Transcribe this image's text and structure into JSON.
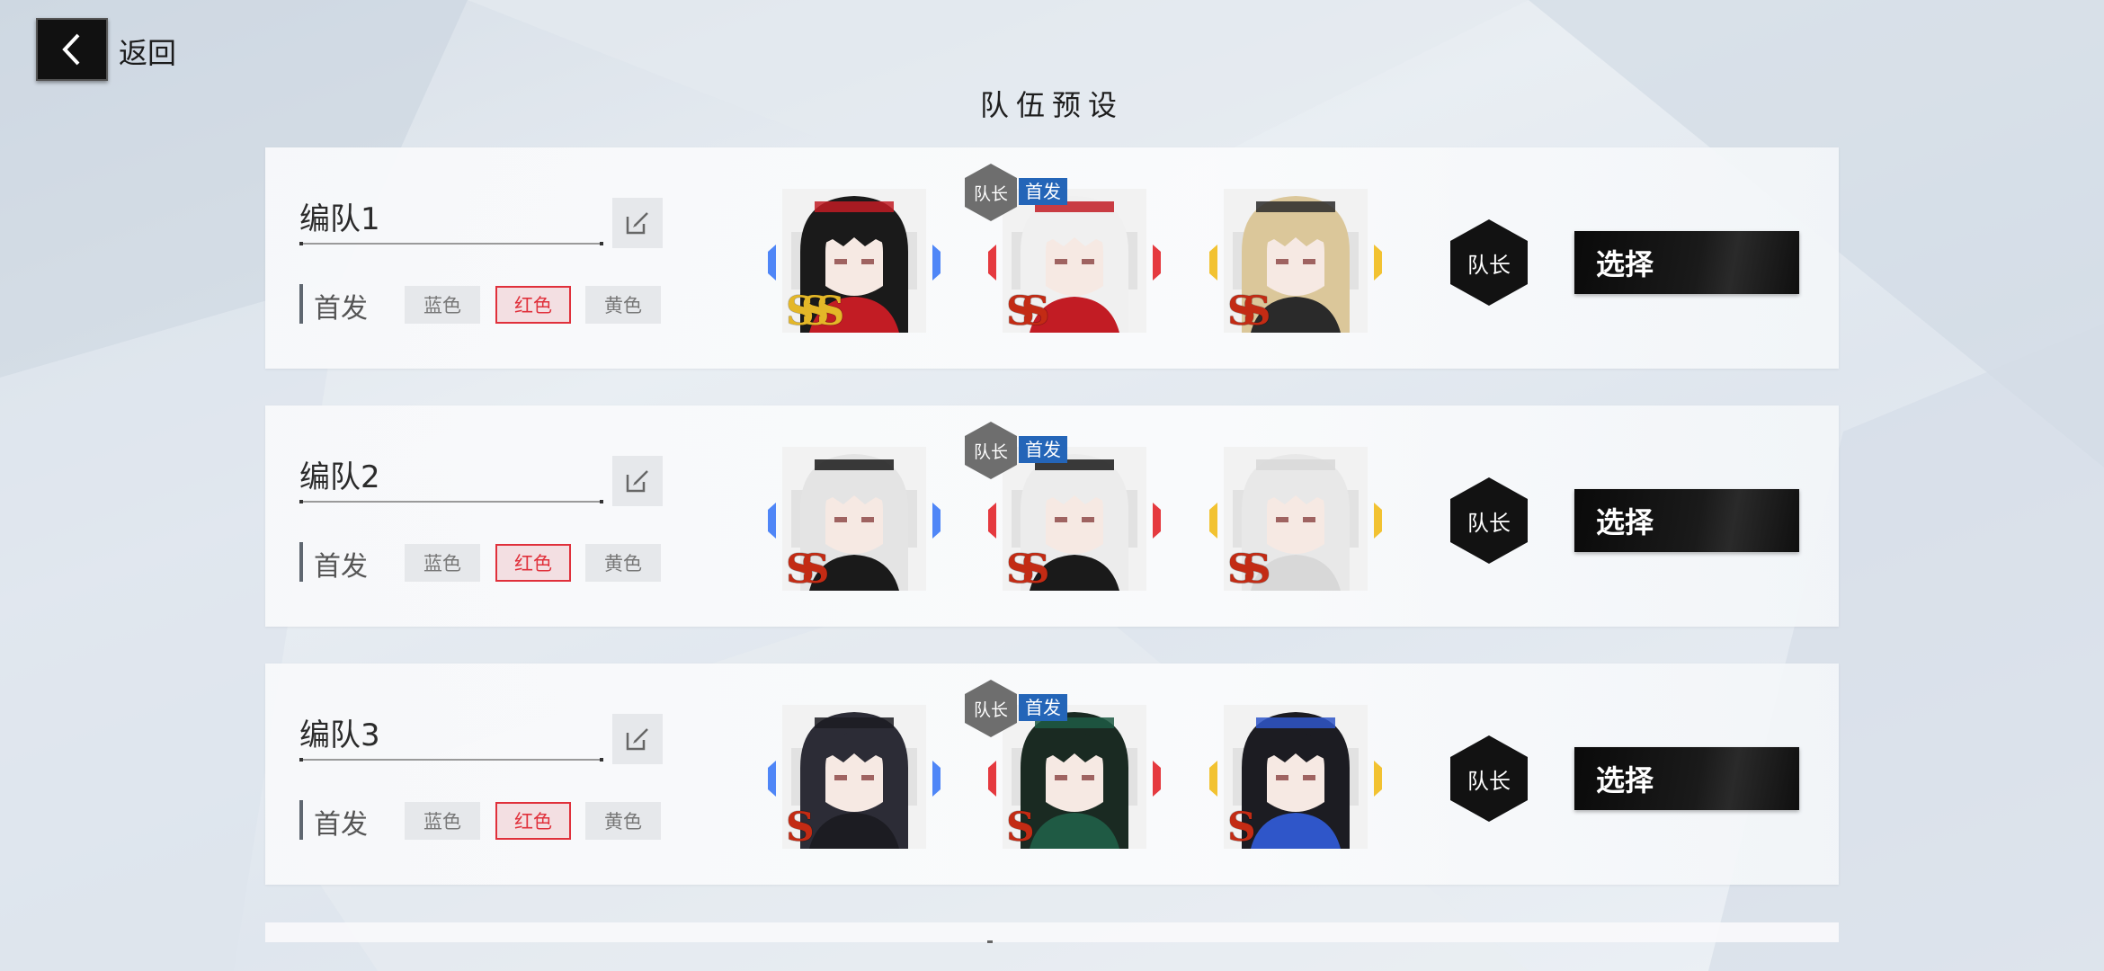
{
  "header": {
    "back_label": "返回",
    "title": "队伍预设"
  },
  "labels": {
    "leader_tag": "队长",
    "first_tag": "首发",
    "lead_label": "首发"
  },
  "teams": [
    {
      "name": "编队1",
      "colors": [
        {
          "label": "蓝色",
          "active": false
        },
        {
          "label": "红色",
          "active": true
        },
        {
          "label": "黄色",
          "active": false
        }
      ],
      "members": [
        {
          "grade": "SSS",
          "grade_color": "gold",
          "element": "blue",
          "hair": "#1a1a1a",
          "accent": "#c21c24"
        },
        {
          "grade": "SS",
          "element": "red",
          "hair": "#f0f0f0",
          "accent": "#c21c24",
          "leader": true
        },
        {
          "grade": "SS",
          "element": "yellow",
          "hair": "#dbc79a",
          "accent": "#2a2a2a"
        }
      ],
      "leader_button": "队长",
      "select_button": "选择"
    },
    {
      "name": "编队2",
      "colors": [
        {
          "label": "蓝色",
          "active": false
        },
        {
          "label": "红色",
          "active": true
        },
        {
          "label": "黄色",
          "active": false
        }
      ],
      "members": [
        {
          "grade": "SS",
          "element": "blue",
          "hair": "#e4e4e4",
          "accent": "#1a1a1a"
        },
        {
          "grade": "SS",
          "element": "red",
          "hair": "#ececec",
          "accent": "#1a1a1a",
          "leader": true
        },
        {
          "grade": "SS",
          "element": "yellow",
          "hair": "#e8e8e8",
          "accent": "#d8d8d8"
        }
      ],
      "leader_button": "队长",
      "select_button": "选择"
    },
    {
      "name": "编队3",
      "colors": [
        {
          "label": "蓝色",
          "active": false
        },
        {
          "label": "红色",
          "active": true
        },
        {
          "label": "黄色",
          "active": false
        }
      ],
      "members": [
        {
          "grade": "S",
          "element": "blue",
          "hair": "#2c2c36",
          "accent": "#1c1c22"
        },
        {
          "grade": "S",
          "element": "red",
          "hair": "#1a2a22",
          "accent": "#1f5a44",
          "leader": true
        },
        {
          "grade": "S",
          "element": "yellow",
          "hair": "#1c1c22",
          "accent": "#2f56c9"
        }
      ],
      "leader_button": "队长",
      "select_button": "选择"
    }
  ],
  "element_colors": {
    "blue": "#4f86f7",
    "red": "#e5393f",
    "yellow": "#f2c231"
  }
}
